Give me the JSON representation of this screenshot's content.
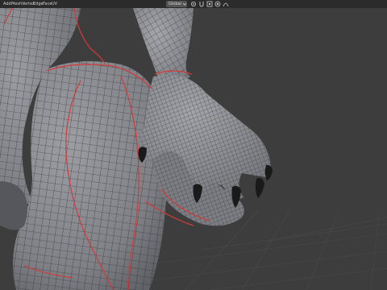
{
  "header": {
    "menu": [
      "Add",
      "Mesh",
      "Vertex",
      "Edge",
      "Face",
      "UV"
    ],
    "orientation_value": "Global",
    "icons": [
      "transform-pivot-icon",
      "snap-icon",
      "magnet-icon",
      "proportional-edit-icon",
      "falloff-icon"
    ]
  },
  "viewport": {
    "grid_color": "#4a4a4a",
    "background_color": "#3d3d3d",
    "mesh_color": "#8b8d92",
    "wire_color": "#2a2b2e",
    "seam_color": "#d23a3a",
    "claw_color": "#1a1a1a"
  }
}
